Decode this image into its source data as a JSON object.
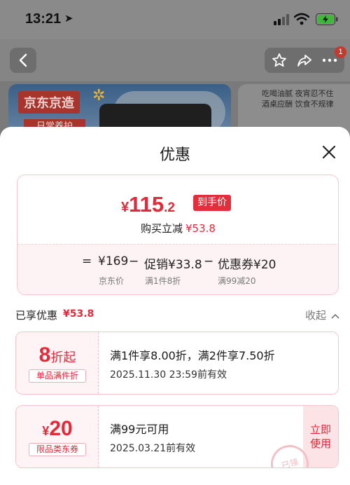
{
  "status_bar": {
    "time": "13:21",
    "location_glyph": "➤"
  },
  "background_page": {
    "badge_count": "1",
    "banner_left": {
      "logo_text": "京东京造",
      "sub_text": "日常养护"
    },
    "banner_right": {
      "lines": [
        "吃喝油腻 夜宵忍不住",
        "酒桌应酬 饮食不规律"
      ]
    }
  },
  "sheet": {
    "title": "优惠",
    "price_card": {
      "currency": "¥",
      "price_int": "115",
      "price_dec": ".2",
      "price_tag": "到手价",
      "instant_cut_label": "购买立减",
      "instant_cut_amount": "¥53.8",
      "formula": {
        "eq": "=",
        "base": "¥169",
        "minus1": "−",
        "promo": "促销¥33.8",
        "minus2": "−",
        "coupon": "优惠券¥20",
        "base_label": "京东价",
        "promo_label": "满1件8折",
        "coupon_label": "满99减20"
      }
    },
    "enjoyed": {
      "label": "已享优惠",
      "amount": "¥53.8",
      "collapse": "收起"
    },
    "coupons": [
      {
        "value_main": "8",
        "value_suffix": "折起",
        "tag": "单品满件折",
        "line1": "满1件享8.00折，满2件享7.50折",
        "line2": "2025.11.30 23:59前有效"
      },
      {
        "value_prefix": "¥",
        "value_main": "20",
        "tag": "限品类东券",
        "line1": "满99元可用",
        "line2": "2025.03.21前有效",
        "use_button": "立即使用",
        "stamp": "已领"
      }
    ]
  },
  "colors": {
    "accent_red": "#e22a3a",
    "coupon_bg": "#fef4f5"
  }
}
